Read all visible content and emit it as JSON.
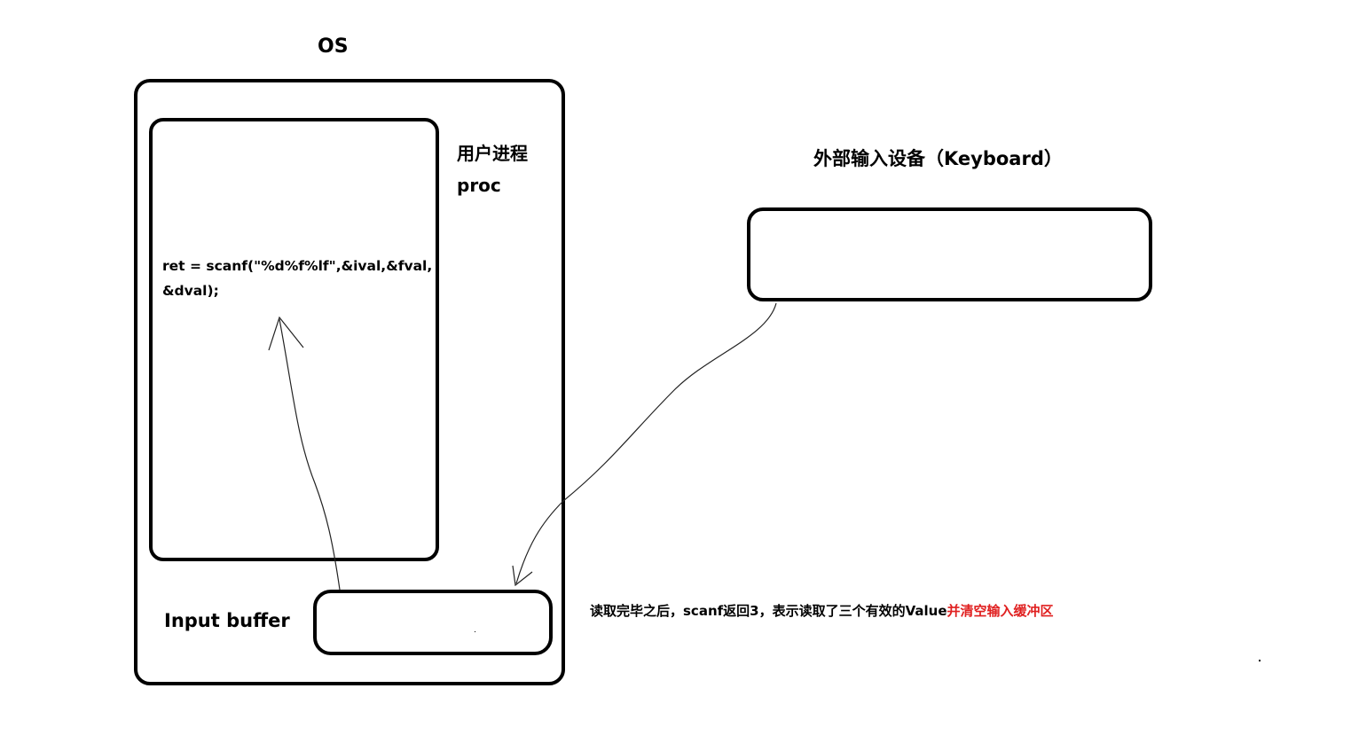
{
  "os": {
    "title": "OS"
  },
  "process": {
    "title_cn": "用户进程",
    "title_en": "proc",
    "code_line1": "ret = scanf(\"%d%f%lf\",&ival,&fval,",
    "code_line2": "&dval);"
  },
  "buffer": {
    "title": "Input buffer"
  },
  "keyboard": {
    "title": "外部输入设备（Keyboard）"
  },
  "note": {
    "main": "读取完毕之后，scanf返回3，表示读取了三个有效的Value",
    "highlight": "并清空输入缓冲区",
    "highlight_color": "#e02020"
  }
}
